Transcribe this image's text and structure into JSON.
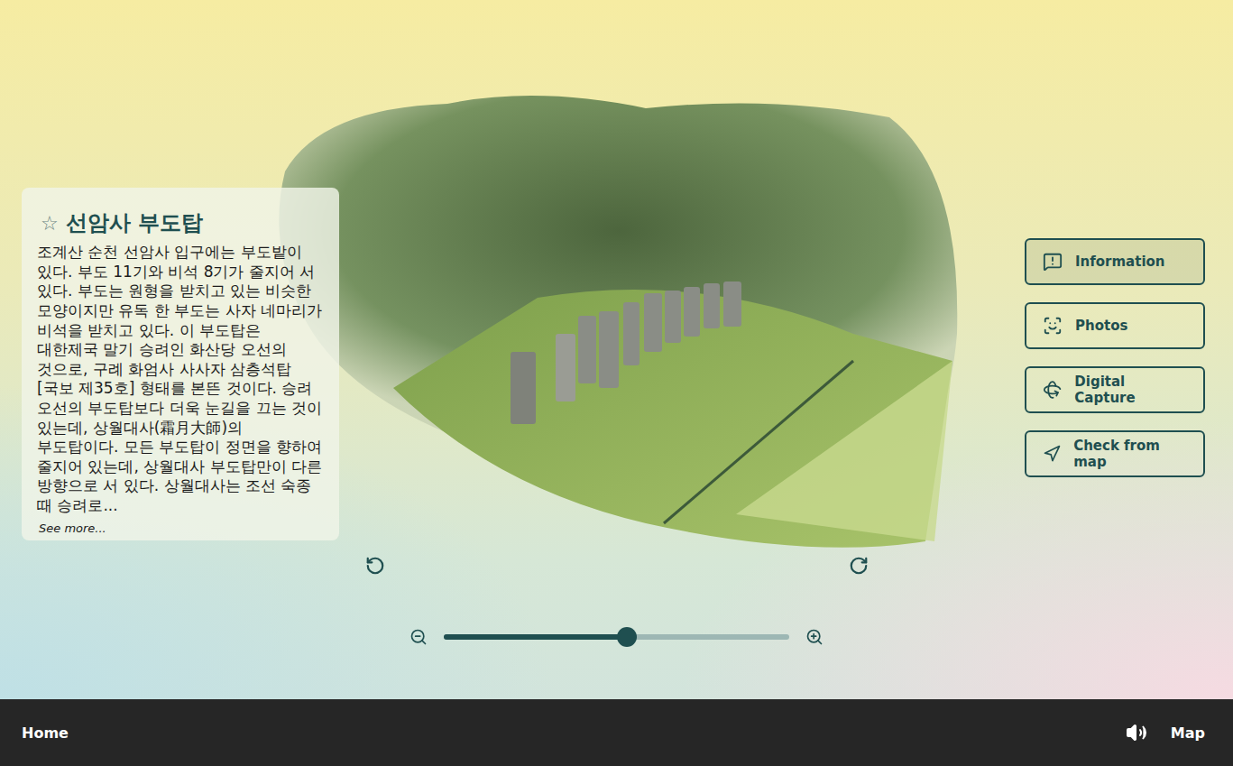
{
  "info_card": {
    "star": "☆",
    "favorite": false,
    "title": "선암사 부도탑",
    "description": "조계산 순천 선암사 입구에는 부도밭이 있다. 부도 11기와 비석 8기가 줄지어 서 있다. 부도는 원형을 받치고 있는 비슷한 모양이지만 유독 한 부도는 사자 네마리가 비석을 받치고 있다. 이 부도탑은 대한제국 말기 승려인 화산당 오선의 것으로, 구례 화엄사 사사자 삼층석탑[국보 제35호] 형태를 본뜬 것이다. 승려 오선의 부도탑보다 더욱 눈길을 끄는 것이 있는데, 상월대사(霜月大師)의 부도탑이다. 모든 부도탑이 정면을 향하여 줄지어 있는데, 상월대사 부도탑만이 다른 방향으로 서 있다. 상월대사는 조선 숙종 때 승려로...",
    "see_more": "See more..."
  },
  "viewer": {
    "zoom": {
      "level": 0.53
    }
  },
  "side_buttons": [
    {
      "label": "Information",
      "selected": true
    },
    {
      "label": "Photos",
      "selected": false
    },
    {
      "label": "Digital Capture",
      "selected": false
    },
    {
      "label": "Check from map",
      "selected": false
    }
  ],
  "footer": {
    "home": "Home",
    "map": "Map"
  }
}
